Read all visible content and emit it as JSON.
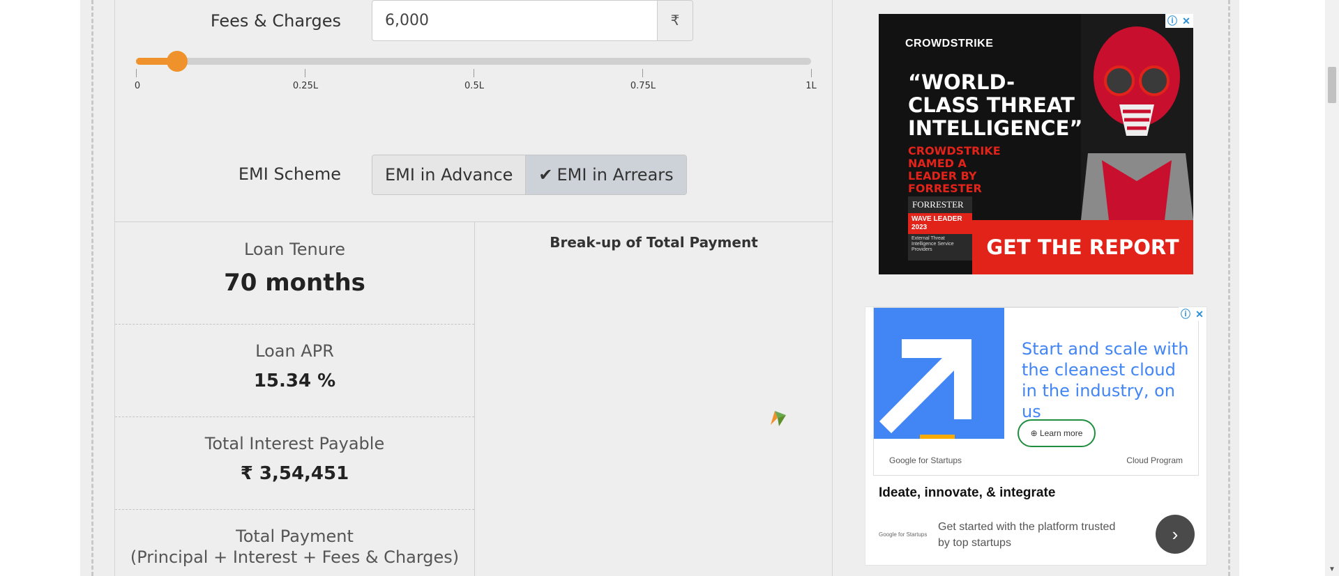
{
  "fees": {
    "label": "Fees & Charges",
    "value": "6,000",
    "currency_symbol": "₹",
    "slider_value_fraction": 0.06,
    "ticks": [
      "0",
      "0.25L",
      "0.5L",
      "0.75L",
      "1L"
    ]
  },
  "emi": {
    "label": "EMI Scheme",
    "options": [
      "EMI in Advance",
      "EMI in Arrears"
    ],
    "selected": "EMI in Arrears"
  },
  "results": {
    "tenure_label": "Loan Tenure",
    "tenure_value": "70 months",
    "apr_label": "Loan APR",
    "apr_value": "15.34 %",
    "interest_label": "Total Interest Payable",
    "interest_value": "₹ 3,54,451",
    "payment_label": "Total Payment",
    "payment_sublabel": "(Principal + Interest + Fees & Charges)"
  },
  "chart": {
    "title": "Break-up of Total Payment"
  },
  "ad1": {
    "brand": "CROWDSTRIKE",
    "headline": "“WORLD-CLASS THREAT INTELLIGENCE”",
    "subhead": "CROWDSTRIKE NAMED A LEADER BY FORRESTER",
    "badge_brand": "FORRESTER",
    "badge_title": "WAVE LEADER 2023",
    "badge_small": "External Threat Intelligence Service Providers",
    "cta": "GET THE REPORT"
  },
  "ad2": {
    "tagline": "Start and scale with the cleanest cloud in the industry, on us",
    "learn_more": "Learn more",
    "left_brand": "Google for Startups",
    "right_brand": "Cloud Program",
    "headline": "Ideate, innovate, & integrate",
    "mini_brand": "Google for Startups",
    "description": "Get started with the platform trusted by top startups"
  },
  "colors": {
    "accent": "#f0922b",
    "crowdstrike_red": "#e2231a",
    "google_blue": "#4285f4"
  }
}
